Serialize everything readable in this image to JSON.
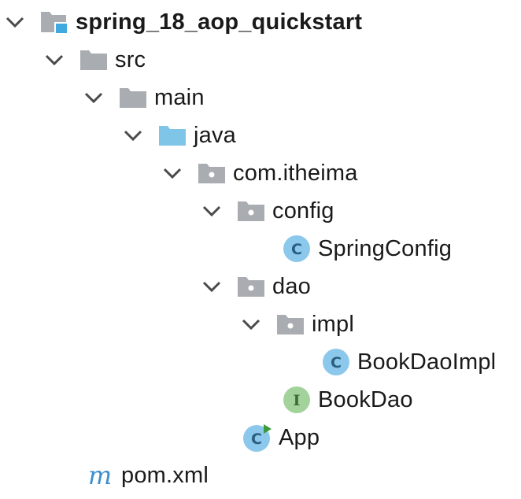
{
  "project_tree": {
    "root": {
      "label": "spring_18_aop_quickstart",
      "icon": "project-module-icon",
      "expanded": true
    },
    "src": {
      "label": "src",
      "icon": "folder-icon",
      "expanded": true
    },
    "main": {
      "label": "main",
      "icon": "folder-icon",
      "expanded": true
    },
    "java": {
      "label": "java",
      "icon": "source-root-folder-icon",
      "expanded": true
    },
    "com_itheima": {
      "label": "com.itheima",
      "icon": "package-icon",
      "expanded": true
    },
    "config": {
      "label": "config",
      "icon": "package-icon",
      "expanded": true
    },
    "spring_config": {
      "label": "SpringConfig",
      "icon": "class-icon",
      "icon_letter": "C"
    },
    "dao": {
      "label": "dao",
      "icon": "package-icon",
      "expanded": true
    },
    "impl": {
      "label": "impl",
      "icon": "package-icon",
      "expanded": true
    },
    "book_dao_impl": {
      "label": "BookDaoImpl",
      "icon": "class-icon",
      "icon_letter": "C"
    },
    "book_dao": {
      "label": "BookDao",
      "icon": "interface-icon",
      "icon_letter": "I"
    },
    "app": {
      "label": "App",
      "icon": "runnable-class-icon",
      "icon_letter": "C"
    },
    "pom": {
      "label": "pom.xml",
      "icon": "maven-icon",
      "icon_letter": "m"
    }
  },
  "colors": {
    "folder_gray": "#a9adb1",
    "source_folder_blue": "#7ec5e8",
    "class_circle": "#8cc8ec",
    "interface_circle": "#a3d39b",
    "chevron": "#4a4a4a",
    "maven_blue": "#3d8fd1",
    "run_green": "#3c9a3c"
  }
}
